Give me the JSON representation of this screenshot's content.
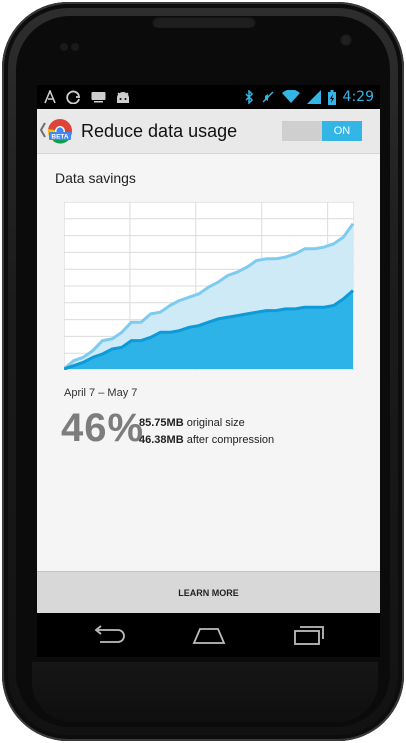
{
  "status_bar": {
    "time": "4:29",
    "left_icons": [
      "notification-icon",
      "sync-icon",
      "keyboard-icon",
      "android-icon"
    ],
    "right_icons": [
      "bluetooth-icon",
      "mute-icon",
      "wifi-icon",
      "signal-icon",
      "battery-icon"
    ]
  },
  "action_bar": {
    "title": "Reduce data usage",
    "app_badge": "BETA",
    "toggle_label": "ON"
  },
  "section": {
    "title": "Data savings"
  },
  "chart_data": {
    "type": "area",
    "title": "",
    "xlabel": "",
    "ylabel": "",
    "grid": true,
    "x": [
      0,
      1,
      2,
      3,
      4,
      5,
      6,
      7,
      8,
      9,
      10,
      11,
      12,
      13,
      14,
      15,
      16,
      17,
      18,
      19,
      20,
      21,
      22,
      23,
      24,
      25,
      26,
      27,
      28,
      29,
      30
    ],
    "series": [
      {
        "values": [
          0,
          0.05,
          0.07,
          0.11,
          0.17,
          0.18,
          0.22,
          0.28,
          0.28,
          0.33,
          0.34,
          0.38,
          0.41,
          0.43,
          0.45,
          0.49,
          0.52,
          0.56,
          0.58,
          0.61,
          0.65,
          0.66,
          0.66,
          0.67,
          0.69,
          0.72,
          0.72,
          0.73,
          0.75,
          0.79,
          0.87
        ]
      },
      {
        "values": [
          0,
          0.02,
          0.04,
          0.07,
          0.09,
          0.12,
          0.13,
          0.17,
          0.17,
          0.19,
          0.22,
          0.22,
          0.23,
          0.25,
          0.26,
          0.28,
          0.3,
          0.31,
          0.32,
          0.33,
          0.34,
          0.35,
          0.35,
          0.36,
          0.36,
          0.37,
          0.37,
          0.37,
          0.38,
          0.42,
          0.47
        ]
      }
    ],
    "colors": {
      "original": "#7dcbee",
      "original_fill": "#cfeaf7",
      "compressed": "#0d9ad8",
      "compressed_fill": "#2db3e8",
      "grid": "#dcdcdc"
    }
  },
  "summary": {
    "date_range": "April 7 – May 7",
    "percent": "46%",
    "original_value": "85.75MB",
    "original_label": " original size",
    "compressed_value": "46.38MB",
    "compressed_label": " after compression"
  },
  "learn_more_label": "LEARN MORE",
  "nav_bar": {
    "buttons": [
      "back-icon",
      "home-icon",
      "recents-icon"
    ]
  },
  "accent_color": "#33b5e5"
}
